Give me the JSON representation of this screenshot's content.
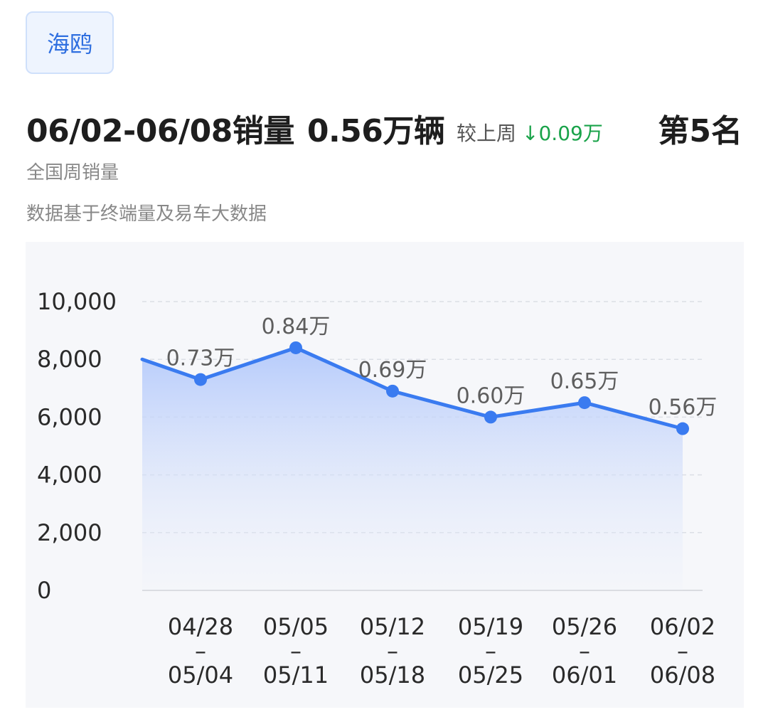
{
  "tag": {
    "label": "海鸥"
  },
  "header": {
    "title": "06/02-06/08销量",
    "value": "0.56万辆",
    "compare_label": "较上周",
    "compare_arrow": "↓",
    "compare_value": "0.09万",
    "rank": "第5名",
    "subtitle": "全国周销量",
    "source_note": "数据基于终端量及易车大数据"
  },
  "colors": {
    "line": "#3a7bf0",
    "down": "#1aa34a",
    "tag_text": "#2f6fe0"
  },
  "chart_data": {
    "type": "area",
    "categories": [
      [
        "04/28",
        "–",
        "05/04"
      ],
      [
        "05/05",
        "–",
        "05/11"
      ],
      [
        "05/12",
        "–",
        "05/18"
      ],
      [
        "05/19",
        "–",
        "05/25"
      ],
      [
        "05/26",
        "–",
        "06/01"
      ],
      [
        "06/02",
        "–",
        "06/08"
      ]
    ],
    "values": [
      7300,
      8400,
      6900,
      6000,
      6500,
      5600
    ],
    "previous_value": 8000,
    "data_labels": [
      "0.73万",
      "0.84万",
      "0.69万",
      "0.60万",
      "0.65万",
      "0.56万"
    ],
    "yticks": [
      "0",
      "2,000",
      "4,000",
      "6,000",
      "8,000",
      "10,000"
    ],
    "ylim": [
      0,
      10000
    ],
    "grid": true,
    "title": "",
    "xlabel": "",
    "ylabel": ""
  }
}
